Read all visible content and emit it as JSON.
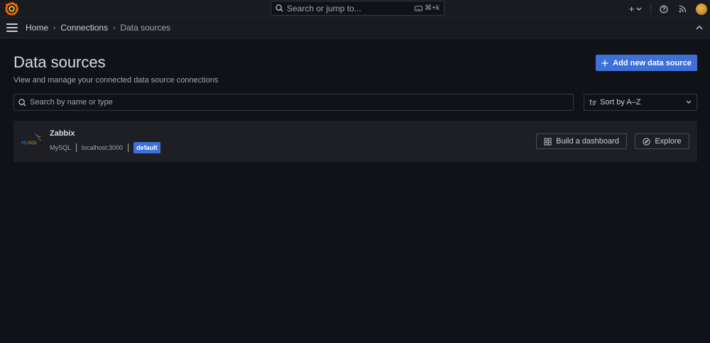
{
  "topbar": {
    "search_placeholder": "Search or jump to...",
    "search_shortcut": "⌘+k",
    "new_label": "+"
  },
  "breadcrumbs": [
    "Home",
    "Connections",
    "Data sources"
  ],
  "page": {
    "title": "Data sources",
    "subtitle": "View and manage your connected data source connections",
    "add_button": "Add new data source"
  },
  "filter": {
    "placeholder": "Search by name or type",
    "sort_label": "Sort by A–Z"
  },
  "datasources": [
    {
      "name": "Zabbix",
      "type": "MySQL",
      "url": "localhost:3000",
      "badge": "default",
      "actions": [
        "Build a dashboard",
        "Explore"
      ]
    }
  ],
  "colors": {
    "primary": "#3d71d9",
    "background": "#111217",
    "panel": "#181b1f",
    "card": "#1e1f24"
  }
}
